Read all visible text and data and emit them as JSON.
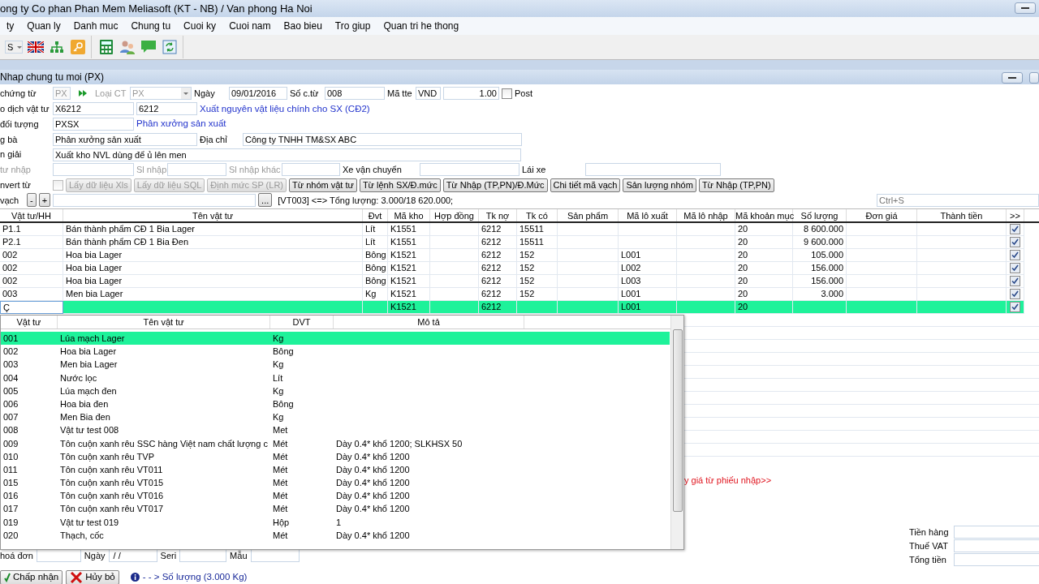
{
  "window": {
    "title": "ong ty Co phan Phan Mem Meliasoft (KT - NB) / Van phong Ha Noi"
  },
  "menu": [
    "ty",
    "Quan ly",
    "Danh muc",
    "Chung tu",
    "Cuoi ky",
    "Cuoi nam",
    "Bao bieu",
    "Tro giup",
    "Quan tri he thong"
  ],
  "toolbar": {
    "combo_value": "S"
  },
  "form_window": {
    "title": "Nhap chung tu moi (PX)"
  },
  "form_rows": [
    {
      "items": [
        {
          "kind": "label",
          "text": "chứng từ"
        },
        {
          "kind": "field",
          "value": "PX",
          "disabled": true
        },
        {
          "kind": "arrows"
        },
        {
          "kind": "label",
          "text": "Loại CT",
          "disabled": true
        },
        {
          "kind": "combo",
          "value": "PX",
          "disabled": true
        },
        {
          "kind": "label",
          "text": "Ngày"
        },
        {
          "kind": "field",
          "value": "09/01/2016"
        },
        {
          "kind": "label",
          "text": "Số c.từ"
        },
        {
          "kind": "field",
          "value": "008"
        },
        {
          "kind": "label",
          "text": "Mã tte"
        },
        {
          "kind": "field",
          "value": "VND"
        },
        {
          "kind": "number",
          "value": "1.00"
        },
        {
          "kind": "checkbox",
          "checked": false
        },
        {
          "kind": "label",
          "text": "Post"
        }
      ]
    },
    {
      "items": [
        {
          "kind": "label",
          "text": "o dịch vật tư"
        },
        {
          "kind": "field",
          "value": "X6212"
        },
        {
          "kind": "field",
          "value": "6212"
        },
        {
          "kind": "note",
          "text": "Xuất nguyên vật liệu chính cho SX (CĐ2)"
        }
      ]
    },
    {
      "items": [
        {
          "kind": "label",
          "text": "đối tượng"
        },
        {
          "kind": "field",
          "value": "PXSX"
        },
        {
          "kind": "note",
          "text": "Phân xưởng sản xuất"
        }
      ]
    },
    {
      "items": [
        {
          "kind": "label",
          "text": "g bà"
        },
        {
          "kind": "field",
          "value": "Phân xưởng sản xuất"
        },
        {
          "kind": "label",
          "text": "Địa chỉ"
        },
        {
          "kind": "field",
          "value": "Công ty TNHH TM&SX ABC"
        }
      ]
    },
    {
      "items": [
        {
          "kind": "label",
          "text": "n giải"
        },
        {
          "kind": "field",
          "value": "Xuất kho NVL dùng để ủ lên men"
        }
      ]
    },
    {
      "items": [
        {
          "kind": "label",
          "text": "tư nhập",
          "disabled": true
        },
        {
          "kind": "field",
          "value": ""
        },
        {
          "kind": "label",
          "text": "Sl nhập",
          "disabled": true
        },
        {
          "kind": "field",
          "value": ""
        },
        {
          "kind": "label",
          "text": "Sl nhập khác",
          "disabled": true
        },
        {
          "kind": "field",
          "value": ""
        },
        {
          "kind": "label",
          "text": "Xe vận chuyển"
        },
        {
          "kind": "field",
          "value": ""
        },
        {
          "kind": "label",
          "text": "Lái xe"
        },
        {
          "kind": "field",
          "value": ""
        }
      ]
    },
    {
      "items": [
        {
          "kind": "label",
          "text": "nvert từ"
        },
        {
          "kind": "checkbox",
          "checked": false,
          "disabled": true
        },
        {
          "kind": "button",
          "text": "Lấy dữ liệu Xls",
          "disabled": true
        },
        {
          "kind": "button",
          "text": "Lấy dữ liệu SQL",
          "disabled": true
        },
        {
          "kind": "button",
          "text": "Định mức SP (LR)",
          "disabled": true
        },
        {
          "kind": "button",
          "text": "Từ nhóm vật tư",
          "disabled": false
        },
        {
          "kind": "button",
          "text": "Từ lệnh SX/Đ.mức",
          "disabled": false
        },
        {
          "kind": "button",
          "text": "Từ Nhập (TP,PN)/Đ.Mức",
          "disabled": false
        },
        {
          "kind": "button",
          "text": "Chi tiết mã vạch",
          "disabled": false
        },
        {
          "kind": "button",
          "text": "Sản lượng nhóm",
          "disabled": false
        },
        {
          "kind": "button",
          "text": "Từ Nhập (TP,PN)",
          "disabled": false
        }
      ]
    },
    {
      "items": [
        {
          "kind": "label",
          "text": "vạch"
        },
        {
          "kind": "button",
          "text": "-",
          "disabled": false
        },
        {
          "kind": "button",
          "text": "+",
          "disabled": false
        },
        {
          "kind": "field",
          "value": ""
        },
        {
          "kind": "button",
          "text": "...",
          "disabled": false
        },
        {
          "kind": "text",
          "text": "[VT003] <=> Tổng lượng: 3.000/18 620.000;"
        },
        {
          "kind": "field",
          "placeholder": "Ctrl+S"
        }
      ]
    }
  ],
  "grid": {
    "columns": [
      "Vật tư/HH",
      "Tên vật tư",
      "Đvt",
      "Mã kho",
      "Hợp đồng",
      "Tk nợ",
      "Tk có",
      "Sản phẩm",
      "Mã lô xuất",
      "Mã lô nhập",
      "Mã khoản mục",
      "Số lượng",
      "Đơn giá",
      "Thành tiền",
      ">>"
    ],
    "rows": [
      {
        "cells": [
          "P1.1",
          "Bán thành phẩm CĐ 1 Bia Lager",
          "Lít",
          "K1551",
          "",
          "6212",
          "15511",
          "",
          "",
          "",
          "20",
          "8 600.000",
          "",
          ""
        ],
        "checked": true,
        "selected": false
      },
      {
        "cells": [
          "P2.1",
          "Bán thành phẩm CĐ 1 Bia Đen",
          "Lít",
          "K1551",
          "",
          "6212",
          "15511",
          "",
          "",
          "",
          "20",
          "9 600.000",
          "",
          ""
        ],
        "checked": true,
        "selected": false
      },
      {
        "cells": [
          "002",
          "Hoa bia Lager",
          "Bông",
          "K1521",
          "",
          "6212",
          "152",
          "",
          "L001",
          "",
          "20",
          "105.000",
          "",
          ""
        ],
        "checked": true,
        "selected": false
      },
      {
        "cells": [
          "002",
          "Hoa bia Lager",
          "Bông",
          "K1521",
          "",
          "6212",
          "152",
          "",
          "L002",
          "",
          "20",
          "156.000",
          "",
          ""
        ],
        "checked": true,
        "selected": false
      },
      {
        "cells": [
          "002",
          "Hoa bia Lager",
          "Bông",
          "K1521",
          "",
          "6212",
          "152",
          "",
          "L003",
          "",
          "20",
          "156.000",
          "",
          ""
        ],
        "checked": true,
        "selected": false
      },
      {
        "cells": [
          "003",
          "Men bia Lager",
          "Kg",
          "K1521",
          "",
          "6212",
          "152",
          "",
          "L001",
          "",
          "20",
          "3.000",
          "",
          ""
        ],
        "checked": true,
        "selected": false
      },
      {
        "cells": [
          "Ç",
          "",
          "",
          "K1521",
          "",
          "6212",
          "",
          "",
          "L001",
          "",
          "20",
          "",
          "",
          ""
        ],
        "checked": true,
        "selected": true
      }
    ]
  },
  "lookup": {
    "columns": [
      "Vật tư",
      "Tên vật tư",
      "DVT",
      "Mô tả"
    ],
    "rows": [
      {
        "cells": [
          "001",
          "Lúa mạch Lager",
          "Kg",
          ""
        ],
        "selected": true
      },
      {
        "cells": [
          "002",
          "Hoa bia Lager",
          "Bông",
          ""
        ],
        "selected": false
      },
      {
        "cells": [
          "003",
          "Men bia Lager",
          "Kg",
          ""
        ],
        "selected": false
      },
      {
        "cells": [
          "004",
          "Nước lọc",
          "Lít",
          ""
        ],
        "selected": false
      },
      {
        "cells": [
          "005",
          "Lúa mạch đen",
          "Kg",
          ""
        ],
        "selected": false
      },
      {
        "cells": [
          "006",
          "Hoa bia đen",
          "Bông",
          ""
        ],
        "selected": false
      },
      {
        "cells": [
          "007",
          "Men Bia đen",
          "Kg",
          ""
        ],
        "selected": false
      },
      {
        "cells": [
          "008",
          "Vật tư test 008",
          "Met",
          ""
        ],
        "selected": false
      },
      {
        "cells": [
          "009",
          "Tôn cuộn xanh rêu SSC hàng Việt nam chất lượng c",
          "Mét",
          "Dày 0.4* khổ 1200;  SLKHSX 50"
        ],
        "selected": false
      },
      {
        "cells": [
          "010",
          "Tôn cuộn xanh rêu TVP",
          "Mét",
          "Dày 0.4* khổ 1200"
        ],
        "selected": false
      },
      {
        "cells": [
          "011",
          "Tôn cuộn xanh rêu VT011",
          "Mét",
          "Dày 0.4* khổ 1200"
        ],
        "selected": false
      },
      {
        "cells": [
          "015",
          "Tôn cuộn xanh rêu VT015",
          "Mét",
          "Dày 0.4* khổ 1200"
        ],
        "selected": false
      },
      {
        "cells": [
          "016",
          "Tôn cuộn xanh rêu VT016",
          "Mét",
          "Dày 0.4* khổ 1200"
        ],
        "selected": false
      },
      {
        "cells": [
          "017",
          "Tôn cuộn xanh rêu VT017",
          "Mét",
          "Dày 0.4* khổ 1200"
        ],
        "selected": false
      },
      {
        "cells": [
          "019",
          "Vật tư test 019",
          "Hộp",
          "1"
        ],
        "selected": false
      },
      {
        "cells": [
          "020",
          "Thạch, cốc",
          "Mét",
          "Dày 0.4* khổ 1200"
        ],
        "selected": false
      }
    ]
  },
  "price_link": "y giá từ phiếu nhập>>",
  "totals": [
    {
      "label": "Tiền hàng"
    },
    {
      "label": "Thuế VAT"
    },
    {
      "label": "Tổng tiền"
    }
  ],
  "invoice": [
    {
      "label": "hoá đơn"
    },
    {
      "label": "Ngày",
      "value": " / /"
    },
    {
      "label": "Seri"
    },
    {
      "label": "Mẫu"
    }
  ],
  "actions": [
    {
      "kind": "accept",
      "text": "Chấp nhận"
    },
    {
      "kind": "cancel",
      "text": "Hủy bỏ"
    }
  ],
  "status": "- - > Số lượng (3.000 Kg)"
}
